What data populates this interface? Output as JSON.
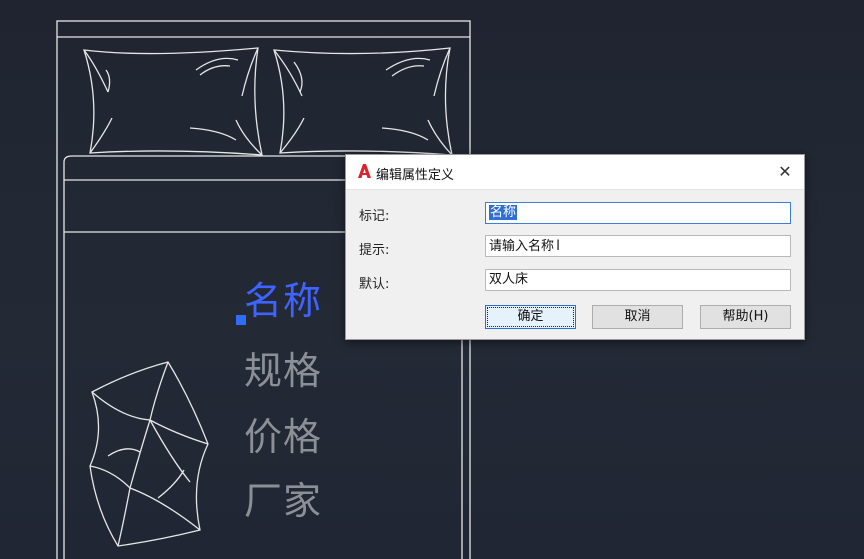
{
  "drawing": {
    "attributes": {
      "name": "名称",
      "spec": "规格",
      "price": "价格",
      "maker": "厂家"
    }
  },
  "dialog": {
    "title": "编辑属性定义",
    "close_label": "✕",
    "tag_label": "标记:",
    "tag_value": "名称",
    "prompt_label": "提示:",
    "prompt_value": "请输入名称",
    "default_label": "默认:",
    "default_value": "双人床",
    "ok_label": "确定",
    "cancel_label": "取消",
    "help_label": "帮助(H)"
  },
  "colors": {
    "background": "#1f2430",
    "line_work": "#e6e6e6",
    "selected_text": "#3f63ff",
    "attribute_text": "#8c8f95",
    "app_icon": "#d9262d"
  },
  "icons": {
    "app": "autocad-logo-icon",
    "close": "close-icon",
    "cursor": "ibeam-cursor-icon",
    "grip": "grip-square-icon"
  }
}
